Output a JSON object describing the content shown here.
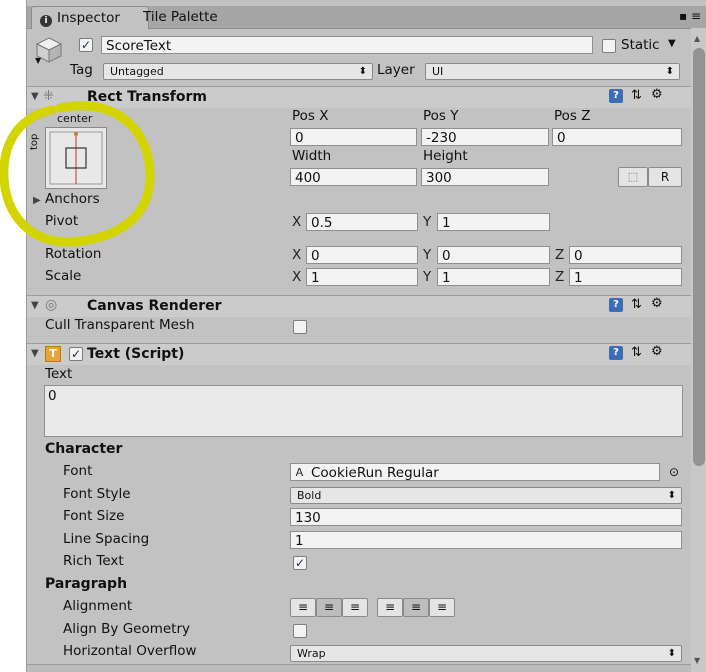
{
  "tabs": {
    "inspector": "Inspector",
    "tile_palette": "Tile Palette"
  },
  "object": {
    "name": "ScoreText",
    "active": true,
    "static_label": "Static",
    "tag_label": "Tag",
    "tag_value": "Untagged",
    "layer_label": "Layer",
    "layer_value": "UI"
  },
  "rect_transform": {
    "title": "Rect Transform",
    "anchor_preset_h": "center",
    "anchor_preset_v": "top",
    "pos_x_label": "Pos X",
    "pos_y_label": "Pos Y",
    "pos_z_label": "Pos Z",
    "pos_x": "0",
    "pos_y": "-230",
    "pos_z": "0",
    "width_label": "Width",
    "height_label": "Height",
    "width": "400",
    "height": "300",
    "raw_button": "R",
    "anchors_label": "Anchors",
    "pivot_label": "Pivot",
    "pivot_x": "0.5",
    "pivot_y": "1",
    "rotation_label": "Rotation",
    "rot_x": "0",
    "rot_y": "0",
    "rot_z": "0",
    "scale_label": "Scale",
    "scale_x": "1",
    "scale_y": "1",
    "scale_z": "1",
    "axis_x": "X",
    "axis_y": "Y",
    "axis_z": "Z"
  },
  "canvas_renderer": {
    "title": "Canvas Renderer",
    "cull_label": "Cull Transparent Mesh",
    "cull_checked": false
  },
  "text_script": {
    "title": "Text (Script)",
    "text_label": "Text",
    "text_value": "0",
    "character_label": "Character",
    "font_label": "Font",
    "font_value": "CookieRun Regular",
    "font_style_label": "Font Style",
    "font_style_value": "Bold",
    "font_size_label": "Font Size",
    "font_size_value": "130",
    "line_spacing_label": "Line Spacing",
    "line_spacing_value": "1",
    "rich_text_label": "Rich Text",
    "rich_text_checked": true,
    "paragraph_label": "Paragraph",
    "alignment_label": "Alignment",
    "align_by_geometry_label": "Align By Geometry",
    "align_by_geometry_checked": false,
    "horizontal_overflow_label": "Horizontal Overflow",
    "horizontal_overflow_value": "Wrap"
  },
  "colors": {
    "panel_bg": "#c2c2c2",
    "highlight_circle": "#d4d400",
    "help_icon": "#3c6db5"
  }
}
